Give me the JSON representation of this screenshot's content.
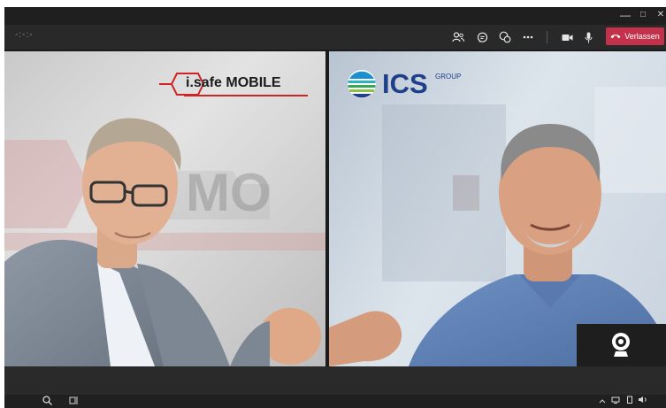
{
  "window": {
    "minimize_glyph": "—",
    "maximize_glyph": "□",
    "close_glyph": "✕"
  },
  "meeting_bar": {
    "timer_text": "-:-:-",
    "leave_label": "Verlassen",
    "icons": [
      "participants-icon",
      "chat-icon",
      "reactions-icon",
      "more-options-icon",
      "camera-icon",
      "microphone-icon",
      "hang-up-icon"
    ]
  },
  "participants": [
    {
      "logo_brand": "i.safe MOBILE",
      "wall_text": "MO"
    },
    {
      "logo_brand": "ICS",
      "logo_suffix": "GROUP"
    }
  ],
  "taskbar": {
    "icons": [
      "search-icon",
      "task-view-icon",
      "chevron-up-icon",
      "network-icon",
      "battery-icon",
      "volume-icon"
    ]
  },
  "colors": {
    "titlebar": "#1f1f1f",
    "meeting_bar": "#292929",
    "leave_button": "#c4314b",
    "isafe_red": "#d02424",
    "ics_blue": "#1f3f8a"
  }
}
